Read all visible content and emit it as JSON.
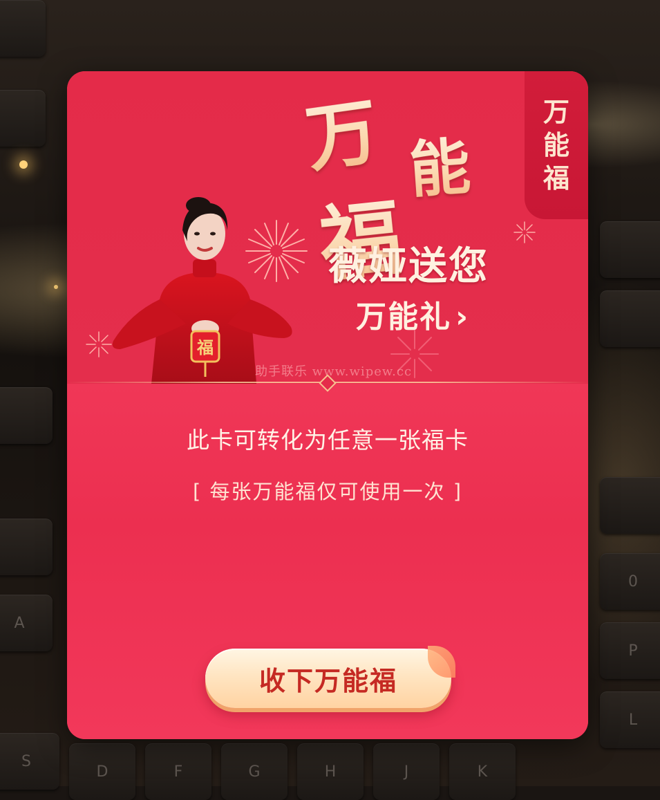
{
  "background": {
    "keys": [
      "A",
      "S",
      "D",
      "F",
      "G",
      "H",
      "J",
      "K",
      "L",
      "P",
      "0"
    ]
  },
  "card": {
    "title_chars": [
      "万",
      "能",
      "福"
    ],
    "side_tag_chars": [
      "万",
      "能",
      "福"
    ],
    "headline": "薇娅送您",
    "subline": "万能礼",
    "subline_chevron": "›",
    "watermark": "助手联乐 www.wipew.cc",
    "lantern_char": "福",
    "description": "此卡可转化为任意一张福卡",
    "note": "[ 每张万能福仅可使用一次 ]",
    "button_label": "收下万能福"
  },
  "colors": {
    "card_red": "#e52a46",
    "side_tag_red": "#c81735",
    "gold_text": "#fbd8b0",
    "button_text": "#c52a23",
    "button_bg": "#ffe5c2"
  }
}
